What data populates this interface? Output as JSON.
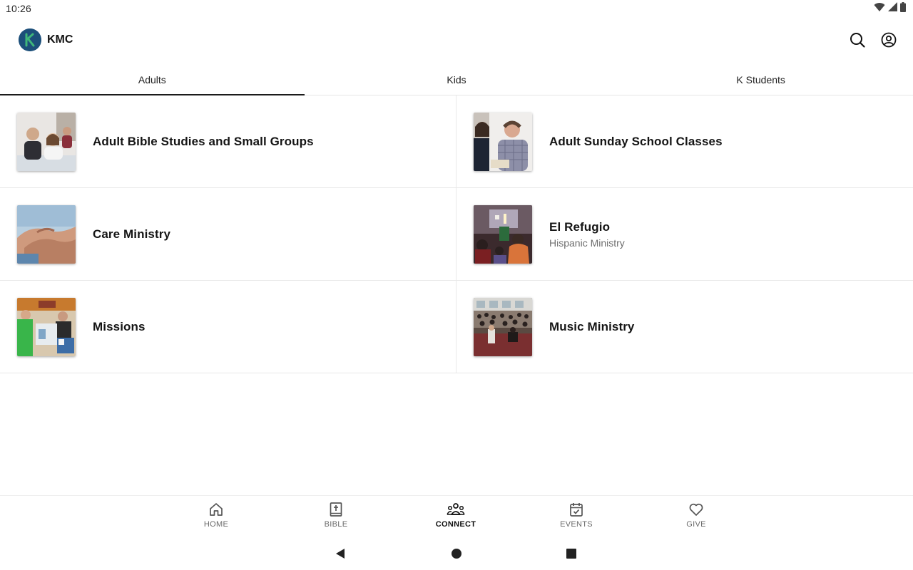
{
  "status_bar": {
    "time": "10:26",
    "wifi_icon": "wifi-icon",
    "signal_icon": "signal-icon",
    "battery_icon": "battery-icon"
  },
  "app_bar": {
    "title": "KMC",
    "logo_letter": "K",
    "search_icon": "search-icon",
    "profile_icon": "account-circle-icon"
  },
  "tabs": [
    {
      "label": "Adults",
      "active": true
    },
    {
      "label": "Kids",
      "active": false
    },
    {
      "label": "K Students",
      "active": false
    }
  ],
  "items": [
    {
      "title": "Adult Bible Studies and Small Groups",
      "subtitle": ""
    },
    {
      "title": "Adult Sunday School Classes",
      "subtitle": ""
    },
    {
      "title": "Care Ministry",
      "subtitle": ""
    },
    {
      "title": "El Refugio",
      "subtitle": "Hispanic Ministry"
    },
    {
      "title": "Missions",
      "subtitle": ""
    },
    {
      "title": "Music Ministry",
      "subtitle": ""
    }
  ],
  "bottom_nav": [
    {
      "label": "HOME",
      "icon": "home-icon",
      "active": false
    },
    {
      "label": "BIBLE",
      "icon": "bible-icon",
      "active": false
    },
    {
      "label": "CONNECT",
      "icon": "people-icon",
      "active": true
    },
    {
      "label": "EVENTS",
      "icon": "calendar-check-icon",
      "active": false
    },
    {
      "label": "GIVE",
      "icon": "heart-icon",
      "active": false
    }
  ],
  "colors": {
    "logo_bg": "#1c4f7a",
    "logo_accent": "#3fb67a",
    "text": "#1b1b1b",
    "muted": "#6e6e6e"
  }
}
